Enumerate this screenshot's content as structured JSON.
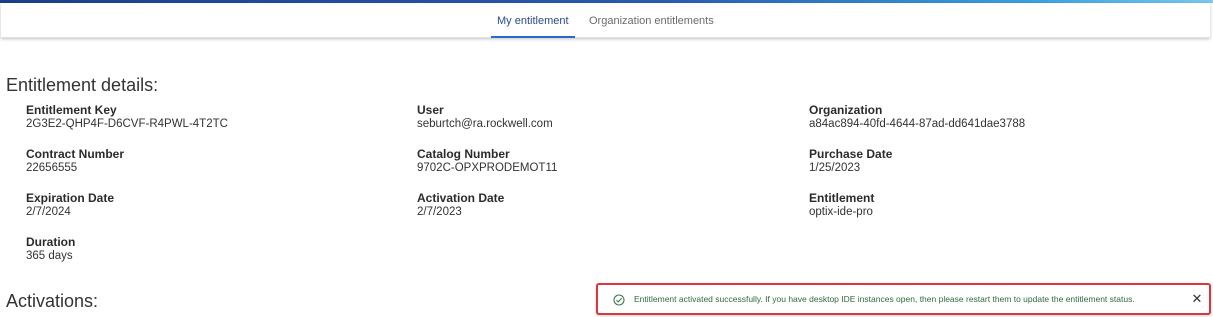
{
  "tabs": [
    {
      "label": "My entitlement",
      "active": true
    },
    {
      "label": "Organization entitlements",
      "active": false
    }
  ],
  "details": {
    "title": "Entitlement details:",
    "fields": {
      "entitlement_key": {
        "label": "Entitlement Key",
        "value": "2G3E2-QHP4F-D6CVF-R4PWL-4T2TC"
      },
      "user": {
        "label": "User",
        "value": "seburtch@ra.rockwell.com"
      },
      "organization": {
        "label": "Organization",
        "value": "a84ac894-40fd-4644-87ad-dd641dae3788"
      },
      "contract_number": {
        "label": "Contract Number",
        "value": "22656555"
      },
      "catalog_number": {
        "label": "Catalog Number",
        "value": "9702C-OPXPRODEMOT11"
      },
      "purchase_date": {
        "label": "Purchase Date",
        "value": "1/25/2023"
      },
      "expiration_date": {
        "label": "Expiration Date",
        "value": "2/7/2024"
      },
      "activation_date": {
        "label": "Activation Date",
        "value": "2/7/2023"
      },
      "entitlement": {
        "label": "Entitlement",
        "value": "optix-ide-pro"
      },
      "duration": {
        "label": "Duration",
        "value": "365 days"
      }
    }
  },
  "activations": {
    "title": "Activations:"
  },
  "toast": {
    "message": "Entitlement activated successfully. If you have desktop IDE instances open, then please restart them to update the entitlement status.",
    "close_symbol": "✕",
    "icon": "check-circle-icon",
    "border_color": "#d9363e",
    "text_color": "#2f6b3a"
  },
  "colors": {
    "accent": "#2a6ad0",
    "active_tab_text": "#2a4b8d"
  }
}
